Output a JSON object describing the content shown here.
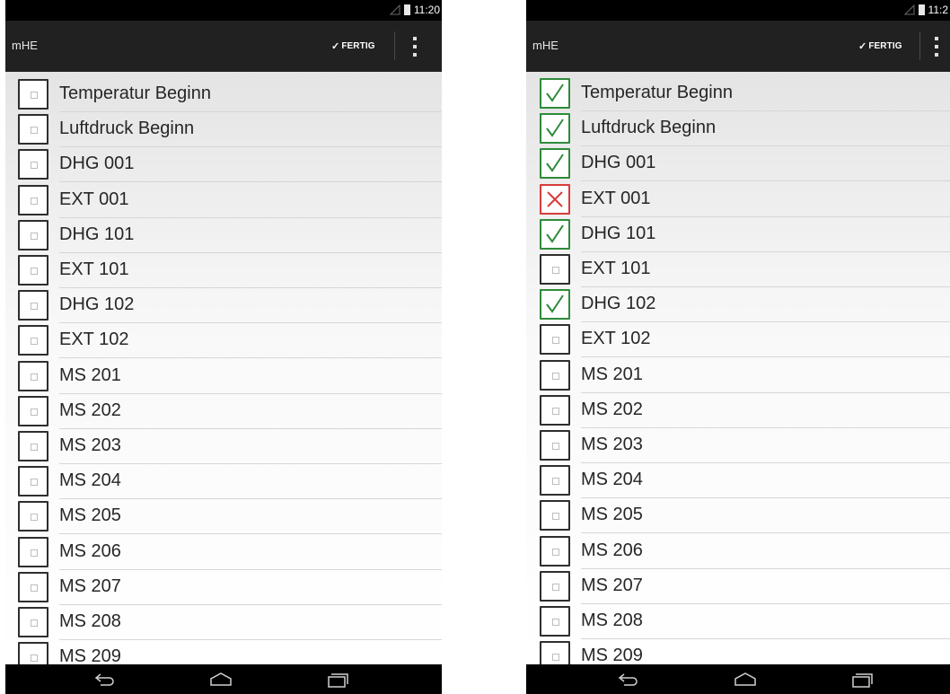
{
  "left": {
    "status_time": "11:20",
    "app_title": "mHE",
    "done_label": "FERTIG",
    "items": [
      {
        "label": "Temperatur Beginn",
        "state": "none"
      },
      {
        "label": "Luftdruck Beginn",
        "state": "none"
      },
      {
        "label": "DHG 001",
        "state": "none"
      },
      {
        "label": "EXT 001",
        "state": "none"
      },
      {
        "label": "DHG 101",
        "state": "none"
      },
      {
        "label": "EXT 101",
        "state": "none"
      },
      {
        "label": "DHG 102",
        "state": "none"
      },
      {
        "label": "EXT 102",
        "state": "none"
      },
      {
        "label": "MS 201",
        "state": "none"
      },
      {
        "label": "MS 202",
        "state": "none"
      },
      {
        "label": "MS 203",
        "state": "none"
      },
      {
        "label": "MS 204",
        "state": "none"
      },
      {
        "label": "MS 205",
        "state": "none"
      },
      {
        "label": "MS 206",
        "state": "none"
      },
      {
        "label": "MS 207",
        "state": "none"
      },
      {
        "label": "MS 208",
        "state": "none"
      },
      {
        "label": "MS 209",
        "state": "none"
      }
    ]
  },
  "right": {
    "status_time": "11:2",
    "app_title": "mHE",
    "done_label": "FERTIG",
    "items": [
      {
        "label": "Temperatur Beginn",
        "state": "checked"
      },
      {
        "label": "Luftdruck Beginn",
        "state": "checked"
      },
      {
        "label": "DHG 001",
        "state": "checked"
      },
      {
        "label": "EXT 001",
        "state": "failed"
      },
      {
        "label": "DHG 101",
        "state": "checked"
      },
      {
        "label": "EXT 101",
        "state": "none"
      },
      {
        "label": "DHG 102",
        "state": "checked"
      },
      {
        "label": "EXT 102",
        "state": "none"
      },
      {
        "label": "MS 201",
        "state": "none"
      },
      {
        "label": "MS 202",
        "state": "none"
      },
      {
        "label": "MS 203",
        "state": "none"
      },
      {
        "label": "MS 204",
        "state": "none"
      },
      {
        "label": "MS 205",
        "state": "none"
      },
      {
        "label": "MS 206",
        "state": "none"
      },
      {
        "label": "MS 207",
        "state": "none"
      },
      {
        "label": "MS 208",
        "state": "none"
      },
      {
        "label": "MS 209",
        "state": "none"
      }
    ]
  },
  "colors": {
    "checked": "#2e8b3a",
    "failed": "#d93b3b",
    "unchecked_border": "#2e2e2e",
    "action_bar": "#212121"
  },
  "icons": {
    "checked": "checkmark-icon",
    "failed": "cross-icon",
    "none": "empty-checkbox-icon",
    "nav": [
      "back-icon",
      "home-icon",
      "recent-apps-icon"
    ]
  }
}
